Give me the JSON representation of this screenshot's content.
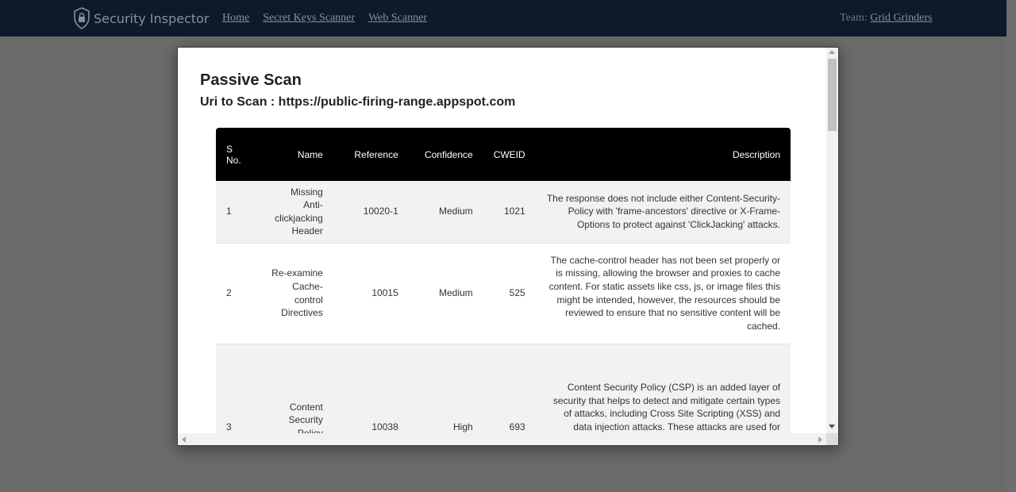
{
  "navbar": {
    "brand": "Security Inspector",
    "brand_icon": "shield-lock-icon",
    "links": [
      "Home",
      "Secret Keys Scanner",
      "Web Scanner"
    ],
    "team_label": "Team:",
    "team_name": "Grid Grinders"
  },
  "modal": {
    "title": "Passive Scan",
    "subtitle": "Uri to Scan : https://public-firing-range.appspot.com",
    "table": {
      "headers": {
        "sno_line1": "S",
        "sno_line2": "No.",
        "name": "Name",
        "reference": "Reference",
        "confidence": "Confidence",
        "cweid": "CWEID",
        "description": "Description"
      },
      "rows": [
        {
          "sno": "1",
          "name": "Missing Anti-clickjacking Header",
          "reference": "10020-1",
          "confidence": "Medium",
          "cweid": "1021",
          "description": "The response does not include either Content-Security-Policy with 'frame-ancestors' directive or X-Frame-Options to protect against 'ClickJacking' attacks."
        },
        {
          "sno": "2",
          "name": "Re-examine Cache-control Directives",
          "reference": "10015",
          "confidence": "Medium",
          "cweid": "525",
          "description": "The cache-control header has not been set properly or is missing, allowing the browser and proxies to cache content. For static assets like css, js, or image files this might be intended, however, the resources should be reviewed to ensure that no sensitive content will be cached."
        },
        {
          "sno": "3",
          "name": "Content Security Policy (CSP)",
          "reference": "10038",
          "confidence": "High",
          "cweid": "693",
          "description": "Content Security Policy (CSP) is an added layer of security that helps to detect and mitigate certain types of attacks, including Cross Site Scripting (XSS) and data injection attacks. These attacks are used for everything from data theft to site defacement or distribution of malware. CSP provides a set of standard HTTP headers that allow"
        }
      ]
    }
  },
  "colors": {
    "navbar_bg": "#0c1a2b",
    "overlay_bg": "#6b6b6b",
    "table_header_bg": "#000000",
    "row_alt_bg": "#f2f2f2"
  }
}
